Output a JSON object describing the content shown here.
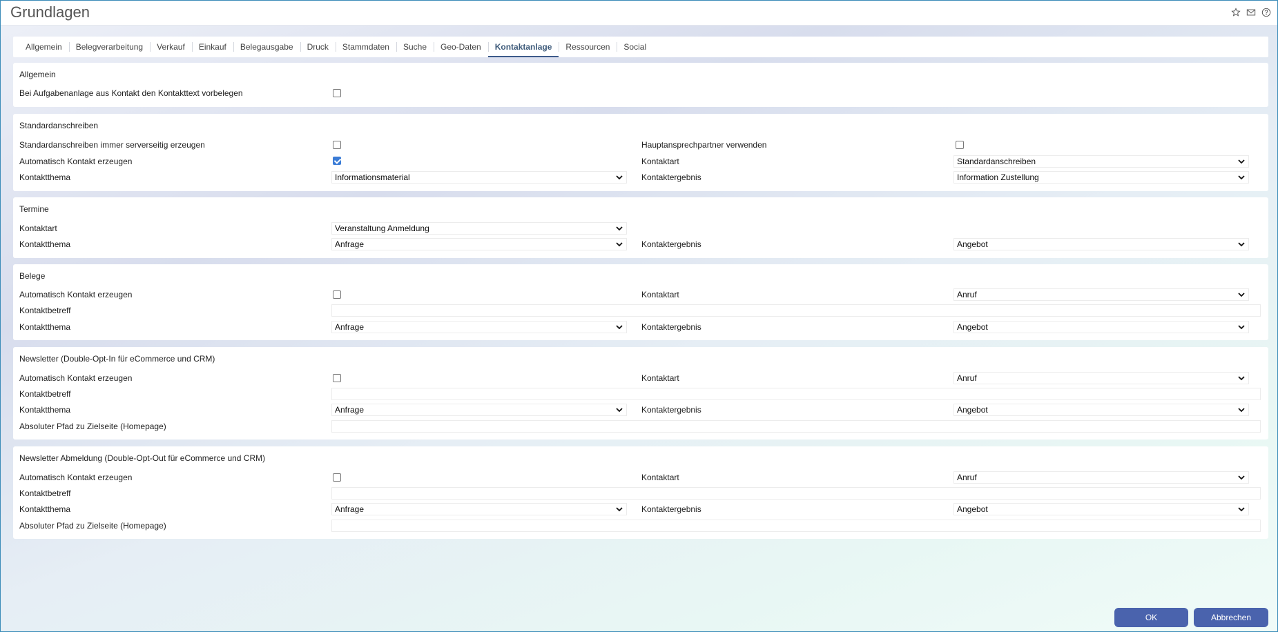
{
  "window": {
    "title": "Grundlagen"
  },
  "tabs": [
    {
      "label": "Allgemein"
    },
    {
      "label": "Belegverarbeitung"
    },
    {
      "label": "Verkauf"
    },
    {
      "label": "Einkauf"
    },
    {
      "label": "Belegausgabe"
    },
    {
      "label": "Druck"
    },
    {
      "label": "Stammdaten"
    },
    {
      "label": "Suche"
    },
    {
      "label": "Geo-Daten"
    },
    {
      "label": "Kontaktanlage"
    },
    {
      "label": "Ressourcen"
    },
    {
      "label": "Social"
    }
  ],
  "active_tab": "Kontaktanlage",
  "allgemein": {
    "title": "Allgemein",
    "vorbelegen_label": "Bei Aufgabenanlage aus Kontakt den Kontakttext vorbelegen",
    "vorbelegen_checked": false
  },
  "standard": {
    "title": "Standardanschreiben",
    "serverseitig_label": "Standardanschreiben immer serverseitig erzeugen",
    "serverseitig_checked": false,
    "haupt_label": "Hauptansprechpartner verwenden",
    "haupt_checked": false,
    "auto_label": "Automatisch Kontakt erzeugen",
    "auto_checked": true,
    "kontaktart_label": "Kontaktart",
    "kontaktart_value": "Standardanschreiben",
    "thema_label": "Kontaktthema",
    "thema_value": "Informationsmaterial",
    "ergebnis_label": "Kontaktergebnis",
    "ergebnis_value": "Information Zustellung"
  },
  "termine": {
    "title": "Termine",
    "kontaktart_label": "Kontaktart",
    "kontaktart_value": "Veranstaltung Anmeldung",
    "thema_label": "Kontaktthema",
    "thema_value": "Anfrage",
    "ergebnis_label": "Kontaktergebnis",
    "ergebnis_value": "Angebot"
  },
  "belege": {
    "title": "Belege",
    "auto_label": "Automatisch Kontakt erzeugen",
    "auto_checked": false,
    "kontaktart_label": "Kontaktart",
    "kontaktart_value": "Anruf",
    "betreff_label": "Kontaktbetreff",
    "betreff_value": "",
    "thema_label": "Kontaktthema",
    "thema_value": "Anfrage",
    "ergebnis_label": "Kontaktergebnis",
    "ergebnis_value": "Angebot"
  },
  "newsletter": {
    "title": "Newsletter (Double-Opt-In für eCommerce und CRM)",
    "auto_label": "Automatisch Kontakt erzeugen",
    "auto_checked": false,
    "kontaktart_label": "Kontaktart",
    "kontaktart_value": "Anruf",
    "betreff_label": "Kontaktbetreff",
    "betreff_value": "",
    "thema_label": "Kontaktthema",
    "thema_value": "Anfrage",
    "ergebnis_label": "Kontaktergebnis",
    "ergebnis_value": "Angebot",
    "pfad_label": "Absoluter Pfad zu Zielseite (Homepage)",
    "pfad_value": ""
  },
  "abmeldung": {
    "title": "Newsletter Abmeldung (Double-Opt-Out für eCommerce und CRM)",
    "auto_label": "Automatisch Kontakt erzeugen",
    "auto_checked": false,
    "kontaktart_label": "Kontaktart",
    "kontaktart_value": "Anruf",
    "betreff_label": "Kontaktbetreff",
    "betreff_value": "",
    "thema_label": "Kontaktthema",
    "thema_value": "Anfrage",
    "ergebnis_label": "Kontaktergebnis",
    "ergebnis_value": "Angebot",
    "pfad_label": "Absoluter Pfad zu Zielseite (Homepage)",
    "pfad_value": ""
  },
  "buttons": {
    "ok": "OK",
    "cancel": "Abbrechen"
  },
  "colors": {
    "accent": "#4a63ad",
    "tab_active": "#3d5a7a",
    "checkbox_checked": "#3b7cd6"
  },
  "icons": [
    "star-icon",
    "mail-icon",
    "help-icon",
    "chevron-down-icon"
  ]
}
